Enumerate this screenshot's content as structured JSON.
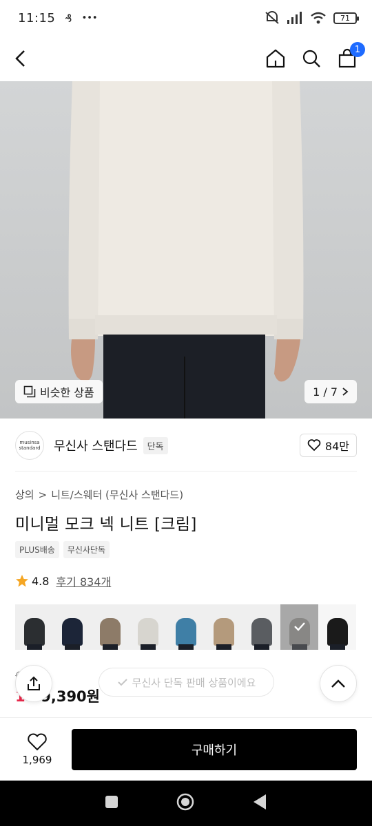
{
  "status_bar": {
    "time": "11:15",
    "more": "•••",
    "battery": "71"
  },
  "nav": {
    "cart_count": "1"
  },
  "hero": {
    "similar_label": "비슷한 상품",
    "pager": "1 / 7"
  },
  "brand": {
    "logo_line1": "musinsa",
    "logo_line2": "standard",
    "name": "무신사 스탠다드",
    "tag": "단독",
    "likes": "84만"
  },
  "breadcrumb": {
    "level1": "상의",
    "separator": ">",
    "level2": "니트/스웨터 (무신사 스탠다드)"
  },
  "product": {
    "title": "미니멀 모크 넥 니트 [크림]",
    "badges": [
      "PLUS배송",
      "무신사단독"
    ],
    "rating": "4.8",
    "reviews": "후기 834개"
  },
  "thumbnails": {
    "colors": [
      "#2b2e31",
      "#1c2538",
      "#8d7b68",
      "#d7d5cf",
      "#3f7fa6",
      "#b49a7c",
      "#5a5d61",
      "#a8a6a2",
      "#1a1a1a"
    ],
    "selected_index": 7
  },
  "price": {
    "original": "6 9원",
    "discount": "1",
    "current": "59,390원"
  },
  "toast": {
    "text": "무신사 단독 판매 상품이에요"
  },
  "bottom": {
    "wish_count": "1,969",
    "buy_label": "구매하기"
  },
  "colors": {
    "accent": "#1e6bff",
    "sale": "#e8294b",
    "star": "#f5a623"
  }
}
